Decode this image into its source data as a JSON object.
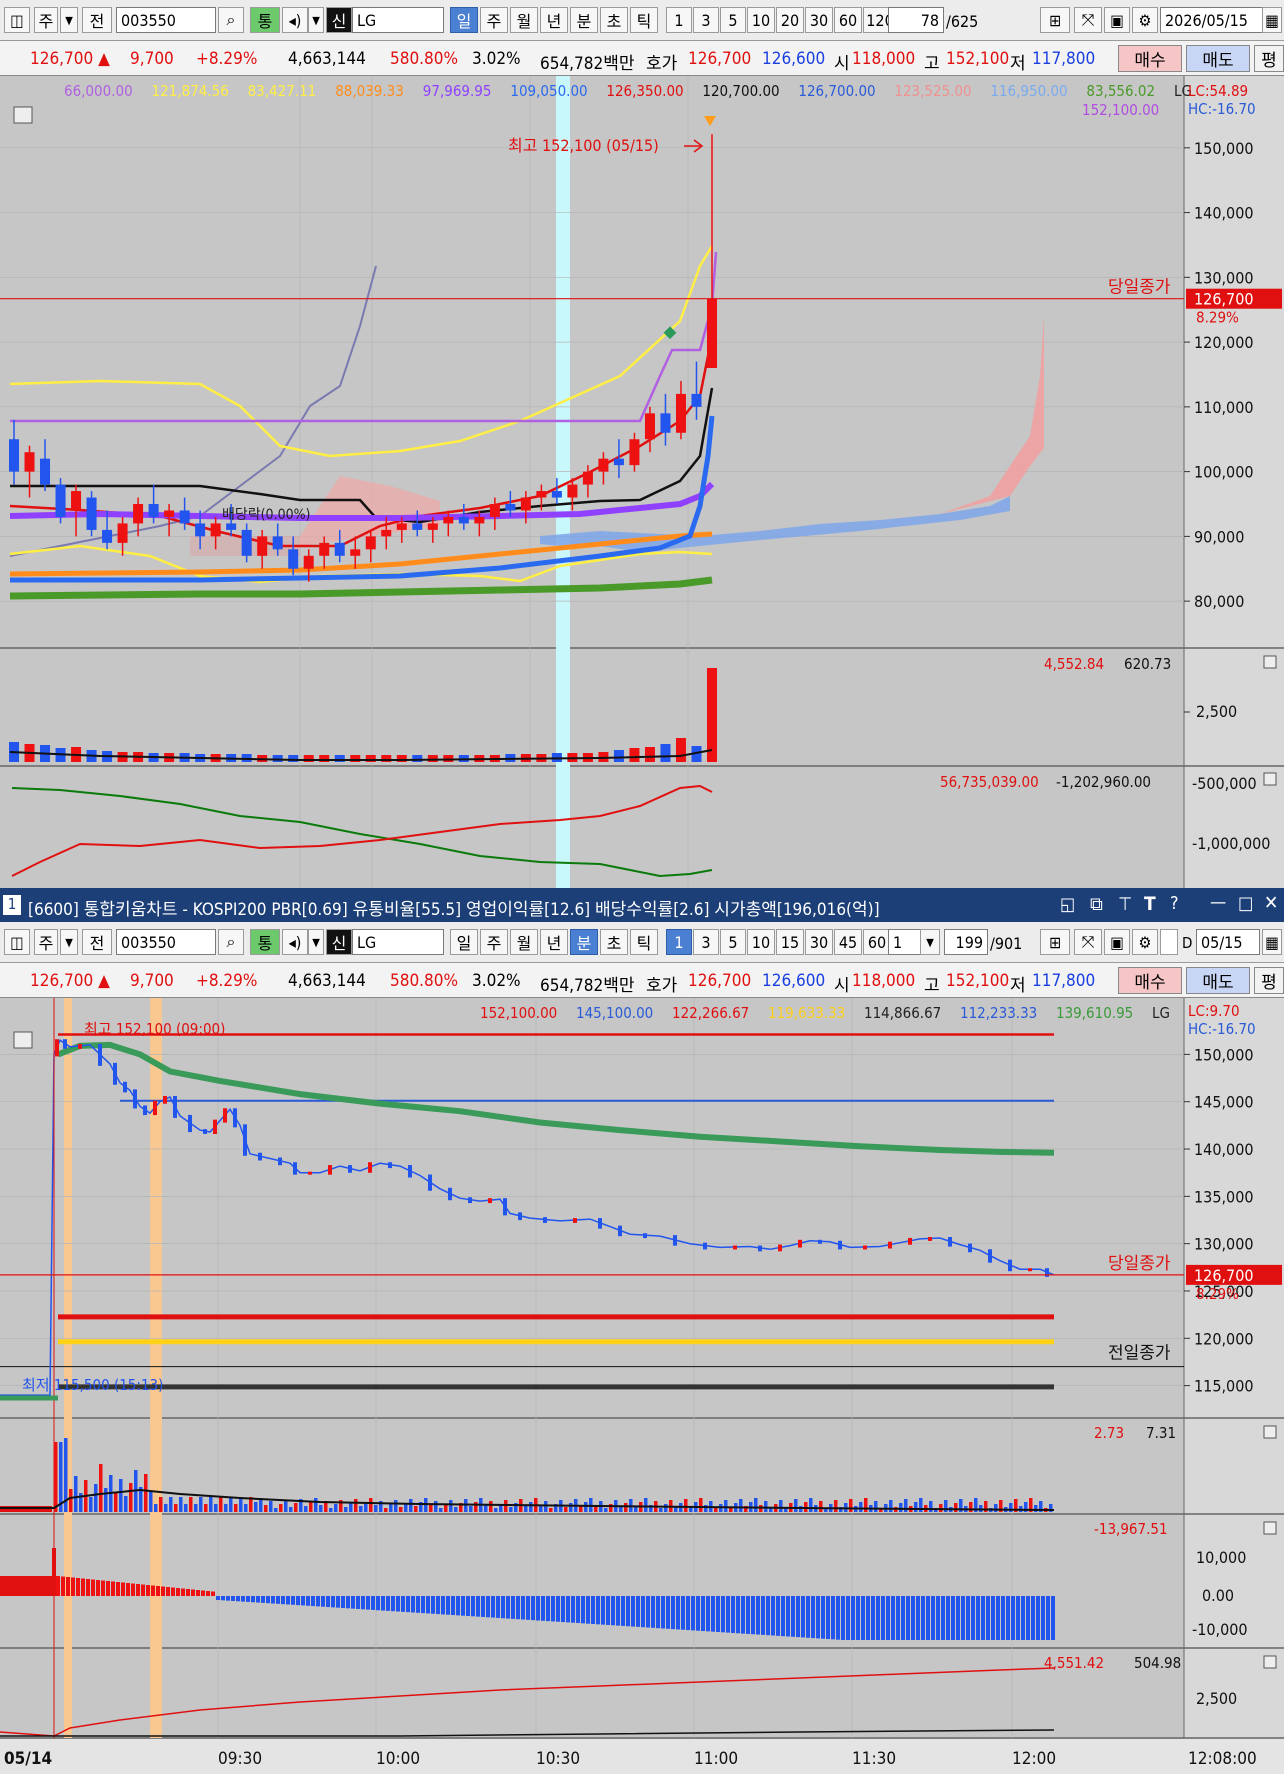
{
  "top": {
    "toolbar": {
      "mode": "주",
      "prev": "전",
      "code": "003550",
      "tong": "통",
      "shin": "신",
      "name": "LG",
      "periods": [
        "일",
        "주",
        "월",
        "년",
        "분",
        "초",
        "틱"
      ],
      "active_period": "일",
      "nums": [
        "1",
        "3",
        "5",
        "10",
        "20",
        "30",
        "60",
        "120"
      ],
      "count": "78",
      "total": "/625",
      "date": "2026/05/15"
    },
    "quote": {
      "price": "126,700",
      "change": "9,700",
      "pct": "+8.29%",
      "volume": "4,663,144",
      "vol_ratio": "580.80%",
      "turnover": "3.02%",
      "amount": "654,782백만",
      "hoga_label": "호가",
      "ask": "126,700",
      "bid": "126,600",
      "open_label": "시",
      "open": "118,000",
      "high_label": "고",
      "high": "152,100",
      "low_label": "저",
      "low": "117,800",
      "buy": "매수",
      "sell": "매도",
      "extra": "평"
    }
  },
  "bottom": {
    "toolbar": {
      "mode": "주",
      "prev": "전",
      "code": "003550",
      "tong": "통",
      "shin": "신",
      "name": "LG",
      "periods": [
        "일",
        "주",
        "월",
        "년",
        "분",
        "초",
        "틱"
      ],
      "active_period": "분",
      "nums": [
        "1",
        "3",
        "5",
        "10",
        "15",
        "30",
        "45",
        "60"
      ],
      "interval": "1",
      "count": "199",
      "total": "/901",
      "d_label": "D",
      "date": "05/15"
    },
    "quote": {
      "price": "126,700",
      "change": "9,700",
      "pct": "+8.29%",
      "volume": "4,663,144",
      "vol_ratio": "580.80%",
      "turnover": "3.02%",
      "amount": "654,782백만",
      "hoga_label": "호가",
      "ask": "126,700",
      "bid": "126,600",
      "open_label": "시",
      "open": "118,000",
      "high_label": "고",
      "high": "152,100",
      "low_label": "저",
      "low": "117,800",
      "buy": "매수",
      "sell": "매도",
      "extra": "평"
    }
  },
  "window_title": "[6600] 통합키움차트 - KOSPI200 PBR[0.69] 유통비율[55.5] 영업이익률[12.6] 배당수익률[2.6] 시가총액[196,016(억)]",
  "window_num": "1",
  "colors": {
    "up": "#ee1111",
    "down": "#2255ee",
    "bg": "#c6c6c6",
    "highlight": "#c8f8fb",
    "band": "#f8c890"
  },
  "chart_data": [
    {
      "type": "candlestick",
      "title": "LG 일봉",
      "ylim": [
        74000,
        158000
      ],
      "yticks": [
        80000,
        90000,
        100000,
        110000,
        120000,
        130000,
        140000,
        150000
      ],
      "ytick_labels": [
        "80,000",
        "90,000",
        "100,000",
        "110,000",
        "120,000",
        "130,000",
        "140,000",
        "150,000"
      ],
      "legend_values": [
        {
          "text": "66,000.00",
          "color": "#b060e0"
        },
        {
          "text": "121,874.56",
          "color": "#ffee44"
        },
        {
          "text": "83,427.11",
          "color": "#ffee44"
        },
        {
          "text": "88,039.33",
          "color": "#ff8c1a"
        },
        {
          "text": "97,969.95",
          "color": "#9040ff"
        },
        {
          "text": "109,050.00",
          "color": "#2a6af0"
        },
        {
          "text": "126,350.00",
          "color": "#e01010"
        },
        {
          "text": "120,700.00",
          "color": "#111111"
        },
        {
          "text": "126,700.00",
          "color": "#2a5ad8"
        },
        {
          "text": "123,525.00",
          "color": "#f09090"
        },
        {
          "text": "116,950.00",
          "color": "#7aaaf0"
        },
        {
          "text": "83,556.02",
          "color": "#4a9a2a"
        },
        {
          "text": "LG",
          "color": "#222222"
        }
      ],
      "legend_row2": "152,100.00",
      "lc": "LC:54.89",
      "hc": "HC:-16.70",
      "high_annotation": "최고 152,100 (05/15)",
      "prev_close_label": "당일종가",
      "price_tag": "126,700",
      "price_pct": "8.29%",
      "dividend_label": "배당락(0.00%)",
      "candles": [
        [
          105000,
          108000,
          98000,
          100000
        ],
        [
          100000,
          104000,
          96000,
          103000
        ],
        [
          102000,
          105000,
          97000,
          98000
        ],
        [
          98000,
          99000,
          92000,
          93000
        ],
        [
          94000,
          98000,
          90000,
          97000
        ],
        [
          96000,
          97000,
          90000,
          91000
        ],
        [
          91000,
          94000,
          88000,
          89000
        ],
        [
          89000,
          93000,
          87000,
          92000
        ],
        [
          92000,
          96000,
          90000,
          95000
        ],
        [
          95000,
          98000,
          92000,
          93000
        ],
        [
          93000,
          95000,
          90000,
          94000
        ],
        [
          94000,
          96000,
          91000,
          92000
        ],
        [
          92000,
          94000,
          88000,
          90000
        ],
        [
          90000,
          93000,
          88000,
          92000
        ],
        [
          92000,
          95000,
          90000,
          91000
        ],
        [
          91000,
          92000,
          86000,
          87000
        ],
        [
          87000,
          91000,
          85000,
          90000
        ],
        [
          90000,
          92000,
          87000,
          88000
        ],
        [
          88000,
          90000,
          84000,
          85000
        ],
        [
          85000,
          88000,
          83000,
          87000
        ],
        [
          87000,
          90000,
          85000,
          89000
        ],
        [
          89000,
          91000,
          86000,
          87000
        ],
        [
          87000,
          90000,
          85000,
          88000
        ],
        [
          88000,
          91000,
          86000,
          90000
        ],
        [
          90000,
          93000,
          88000,
          91000
        ],
        [
          91000,
          93000,
          89000,
          92000
        ],
        [
          92000,
          94000,
          90000,
          91000
        ],
        [
          91000,
          93000,
          89000,
          92000
        ],
        [
          92000,
          94000,
          90000,
          93000
        ],
        [
          93000,
          95000,
          91000,
          92000
        ],
        [
          92000,
          94000,
          90000,
          93000
        ],
        [
          93000,
          96000,
          91000,
          95000
        ],
        [
          95000,
          97000,
          93000,
          94000
        ],
        [
          94000,
          97000,
          92000,
          96000
        ],
        [
          96000,
          98000,
          94000,
          97000
        ],
        [
          97000,
          99000,
          95000,
          96000
        ],
        [
          96000,
          99000,
          94000,
          98000
        ],
        [
          98000,
          101000,
          96000,
          100000
        ],
        [
          100000,
          103000,
          98000,
          102000
        ],
        [
          102000,
          105000,
          99000,
          101000
        ],
        [
          101000,
          106000,
          100000,
          105000
        ],
        [
          105000,
          110000,
          103000,
          109000
        ],
        [
          109000,
          112000,
          104000,
          106000
        ],
        [
          106000,
          114000,
          105000,
          112000
        ],
        [
          112000,
          117000,
          108000,
          110000
        ],
        [
          116000,
          152100,
          117800,
          126700
        ]
      ],
      "volume": {
        "legend": [
          {
            "text": "4,552.84",
            "color": "#e01010"
          },
          {
            "text": "620.73",
            "color": "#111111"
          }
        ],
        "ytick_labels": [
          "2,500"
        ]
      },
      "indicator": {
        "legend": [
          {
            "text": "56,735,039.00",
            "color": "#e01010"
          },
          {
            "text": "-1,202,960.00",
            "color": "#111111"
          }
        ],
        "ytick_labels": [
          "-500,000",
          "-1,000,000"
        ]
      }
    },
    {
      "type": "candlestick",
      "title": "LG 1분봉",
      "ylim": [
        112000,
        153000
      ],
      "yticks": [
        115000,
        120000,
        125000,
        130000,
        135000,
        140000,
        145000,
        150000
      ],
      "ytick_labels": [
        "115,000",
        "120,000",
        "125,000",
        "130,000",
        "135,000",
        "140,000",
        "145,000",
        "150,000"
      ],
      "legend_values": [
        {
          "text": "152,100.00",
          "color": "#e01010"
        },
        {
          "text": "145,100.00",
          "color": "#2a5ad8"
        },
        {
          "text": "122,266.67",
          "color": "#e01010"
        },
        {
          "text": "119,633.33",
          "color": "#ffd21a"
        },
        {
          "text": "114,866.67",
          "color": "#222222"
        },
        {
          "text": "112,233.33",
          "color": "#2a5ad8"
        },
        {
          "text": "139,610.95",
          "color": "#3a9a3a"
        },
        {
          "text": "LG",
          "color": "#222222"
        }
      ],
      "lc": "LC:9.70",
      "hc": "HC:-16.70",
      "high_annotation": "최고 152,100 (09:00)",
      "low_annotation": "최저 115,500 (15:13)",
      "prev_close_label": "당일종가",
      "price_tag": "126,700",
      "price_pct": "8.29%",
      "yesterday_label": "전일종가",
      "xticks": [
        "05/14",
        "09:30",
        "10:00",
        "10:30",
        "11:00",
        "11:30",
        "12:00",
        "12:08:00"
      ],
      "volume": {
        "legend": [
          {
            "text": "2.73",
            "color": "#e01010"
          },
          {
            "text": "7.31",
            "color": "#111111"
          }
        ]
      },
      "macd": {
        "legend": [
          {
            "text": "-13,967.51",
            "color": "#e01010"
          }
        ],
        "ytick_labels": [
          "10,000",
          "0.00",
          "-10,000"
        ]
      },
      "obv": {
        "legend": [
          {
            "text": "4,551.42",
            "color": "#e01010"
          },
          {
            "text": "504.98",
            "color": "#111111"
          }
        ],
        "ytick_labels": [
          "2,500"
        ]
      }
    }
  ]
}
